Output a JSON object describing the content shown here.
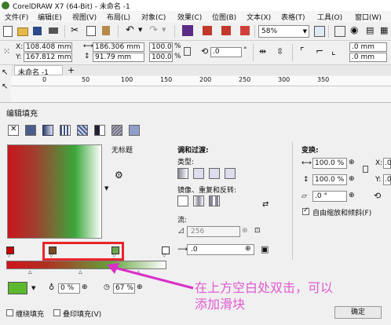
{
  "window": {
    "title": "CorelDRAW X7 (64-Bit) - 未命名 -1"
  },
  "menu": [
    {
      "label": "文件(F)"
    },
    {
      "label": "编辑(E)"
    },
    {
      "label": "视图(V)"
    },
    {
      "label": "布局(L)"
    },
    {
      "label": "对象(C)"
    },
    {
      "label": "效果(C)"
    },
    {
      "label": "位图(B)"
    },
    {
      "label": "文本(X)"
    },
    {
      "label": "表格(T)"
    },
    {
      "label": "工具(O)"
    },
    {
      "label": "窗口(W)"
    }
  ],
  "toolbar": {
    "zoom": "58%"
  },
  "props": {
    "x": "108.408 mm",
    "y": "167.812 mm",
    "w": "186.306 mm",
    "h": "91.79 mm",
    "sx": "100.0",
    "sy": "100.0",
    "pct": "%",
    "angle": ".0",
    "deg": "°",
    "corner1": ".0 mm",
    "corner2": ".0 mm"
  },
  "doc_tab": {
    "label": "未命名 -1",
    "add": "+"
  },
  "ruler": {
    "ticks": [
      "0",
      "50",
      "100",
      "150",
      "200",
      "250",
      "300",
      "350"
    ]
  },
  "dialog": {
    "title": "编辑填充",
    "untitled": "无标题",
    "blend_heading": "调和过渡:",
    "type_label": "类型:",
    "mirror_label": "镜像、重复和反转:",
    "flow_label": "流:",
    "flow_value": "256",
    "accel_value": ".0",
    "transform_heading": "变换:",
    "tw": "100.0 %",
    "th": "100.0 %",
    "tx_label": "X:",
    "tx_value": ".0",
    "ty_label": "Y:",
    "ty_value": ".0",
    "rot": ".0 °",
    "free_scale": "自由缩放和倾斜(F)",
    "opacity": "0 %",
    "position": "67 %",
    "wrap_fill": "缠绕填充",
    "overprint_fill": "叠印填充(V)",
    "ok": "确定"
  },
  "annotation": {
    "line1": "在上方空白处双击，可以",
    "line2": "添加滑块"
  },
  "colors": {
    "accent_red": "#e8252a",
    "annotation_text": "#e05ad0",
    "green": "#5cb82c",
    "node_red": "#cc0000",
    "node_brown": "#7a4a1e",
    "node_green": "#6aa84f"
  }
}
